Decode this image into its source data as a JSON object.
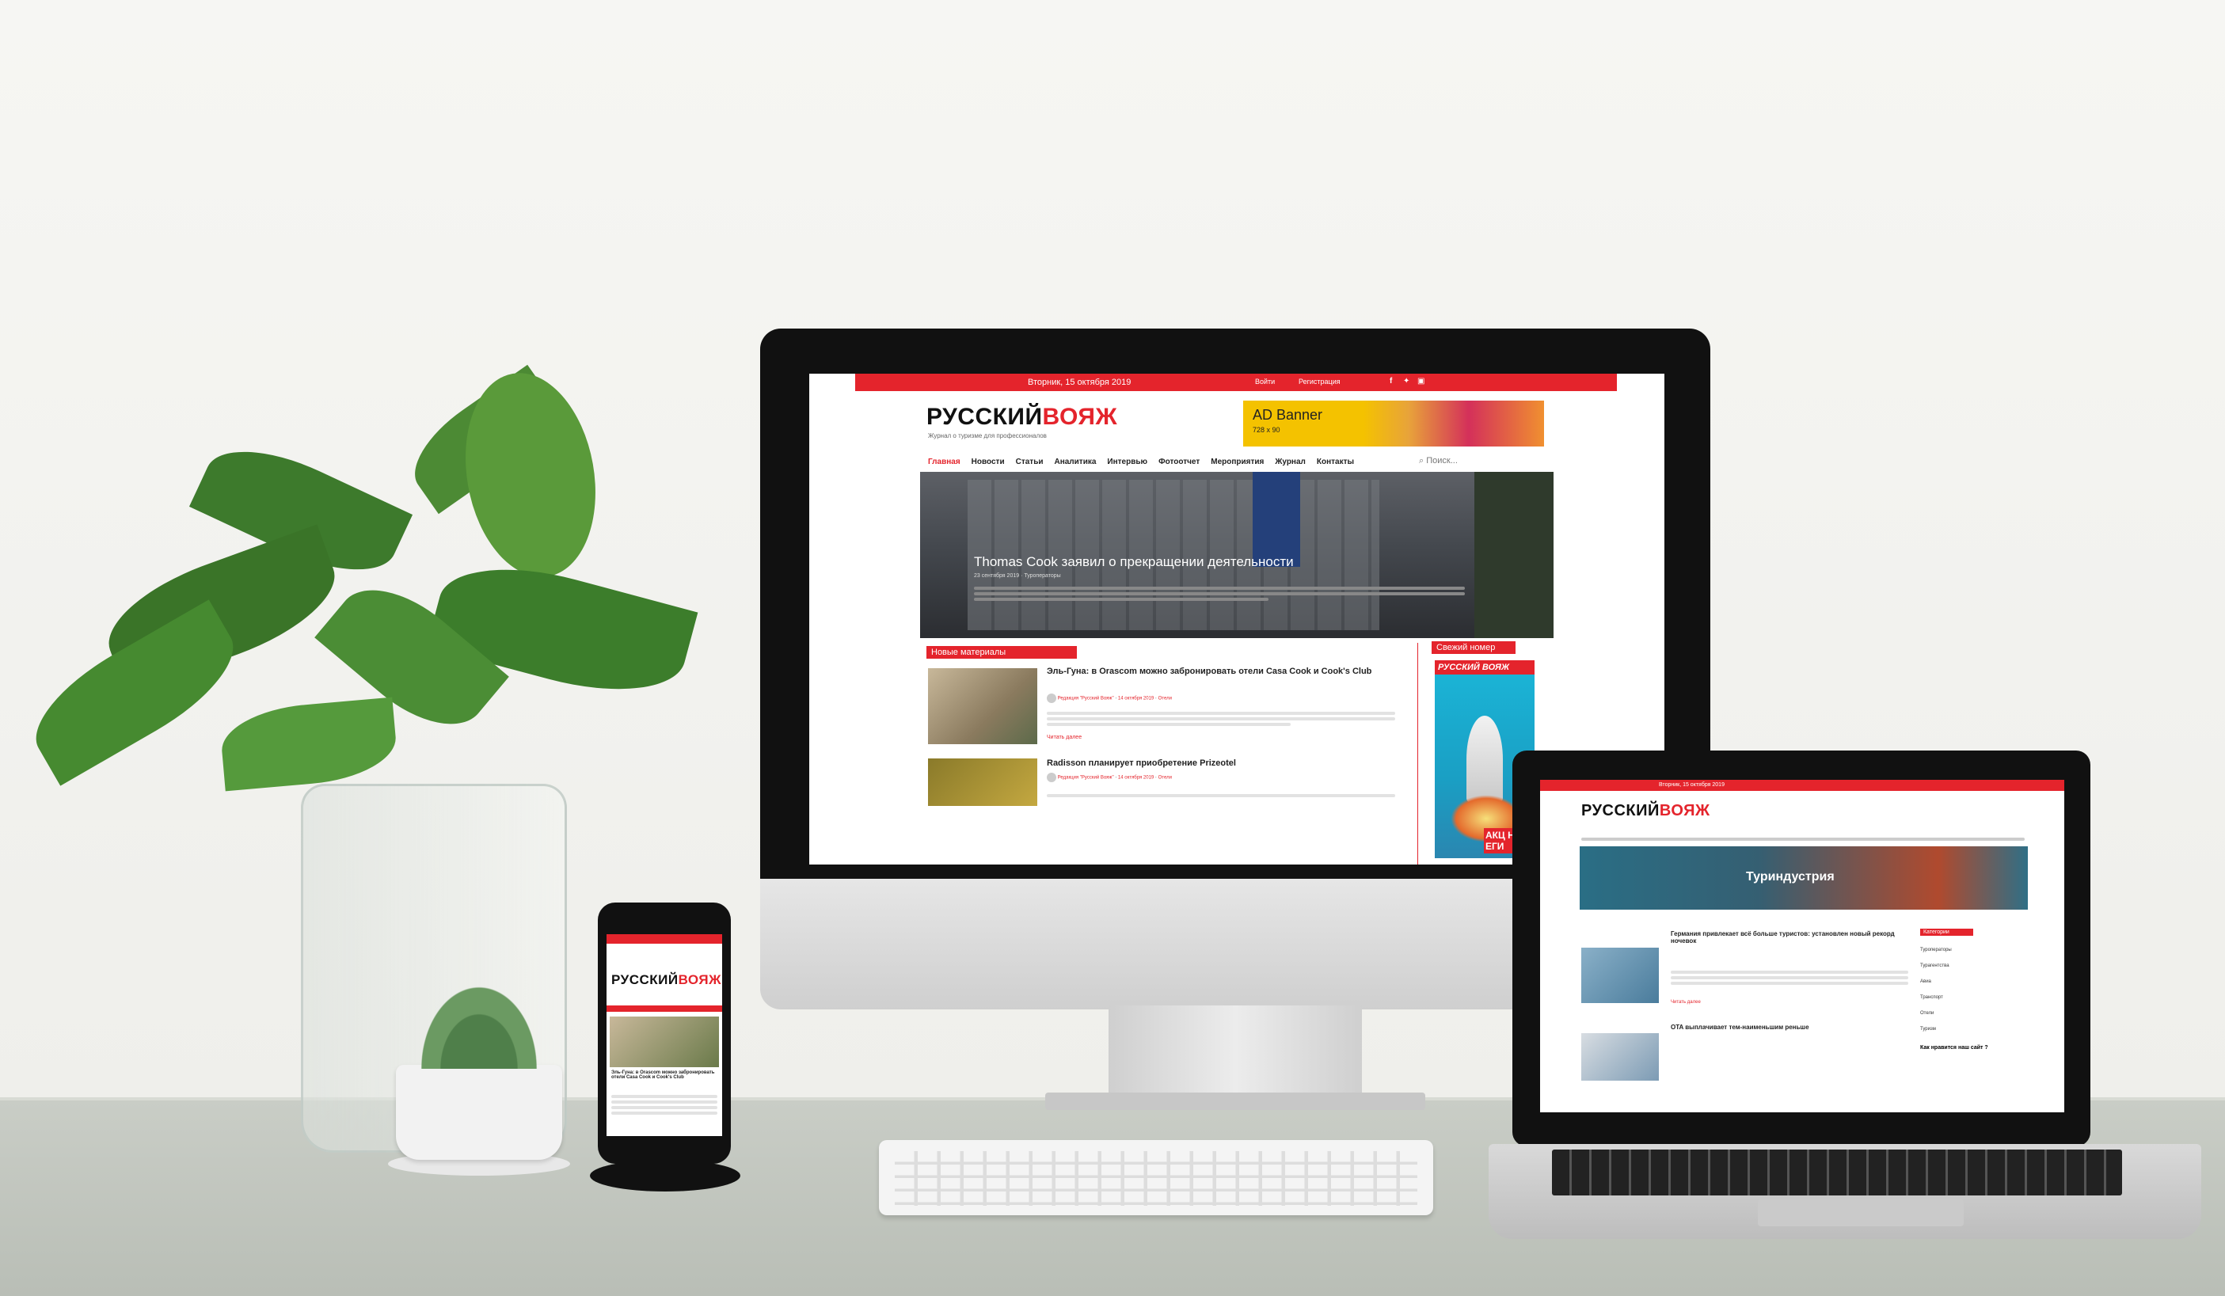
{
  "desktop": {
    "top_date": "Вторник, 15 октября 2019",
    "login": "Войти",
    "register": "Регистрация",
    "social": [
      "f",
      "t",
      "ig"
    ],
    "logo_black": "РУССКИЙ",
    "logo_red": "ВОЯЖ",
    "tagline": "Журнал о туризме для профессионалов",
    "ad_title": "AD Banner",
    "ad_size": "728 x 90",
    "nav": [
      "Главная",
      "Новости",
      "Статьи",
      "Аналитика",
      "Интервью",
      "Фотоотчет",
      "Мероприятия",
      "Журнал",
      "Контакты"
    ],
    "search_placeholder": "Поиск...",
    "hero_title": "Thomas Cook заявил о прекращении деятельности",
    "hero_meta": "23 сентября 2019 · Туроператоры",
    "section_new": "Новые материалы",
    "section_issue": "Свежий номер",
    "article1_title": "Эль-Гуна: в Orascom можно забронировать отели Casa Cook и Cook's Club",
    "article1_author": "Редакция \"Русский Вояж\"",
    "article1_date": "14 октября 2019",
    "article1_cat": "Отели",
    "read_more": "Читать далее",
    "article2_title": "Radisson планирует приобретение Prizeotel",
    "article2_author": "Редакция \"Русский Вояж\"",
    "article2_date": "14 октября 2019",
    "article2_cat": "Отели",
    "magazine_logo": "РУССКИЙ ВОЯЖ",
    "magazine_bottom": "АКЦ НА ЕГИ"
  },
  "laptop": {
    "top_date": "Вторник, 15 октября 2019",
    "logo_black": "РУССКИЙ",
    "logo_red": "ВОЯЖ",
    "hero_title": "Туриндустрия",
    "article1_title": "Германия привлекает всё больше туристов: установлен новый рекорд ночевок",
    "article2_title": "OTA выплачивает тем-наименьшим реньше",
    "side_title": "Категории",
    "side_items": [
      "Туроператоры",
      "Турагентства",
      "Авиа",
      "Транспорт",
      "Отели",
      "Туризм"
    ],
    "poll_title": "Как нравится наш сайт ?",
    "read_more": "Читать далее"
  },
  "phone": {
    "logo_black": "РУССКИЙ",
    "logo_red": "ВОЯЖ",
    "article_title": "Эль-Гуна: в Orascom можно забронировать отели Casa Cook и Cook's Club"
  }
}
